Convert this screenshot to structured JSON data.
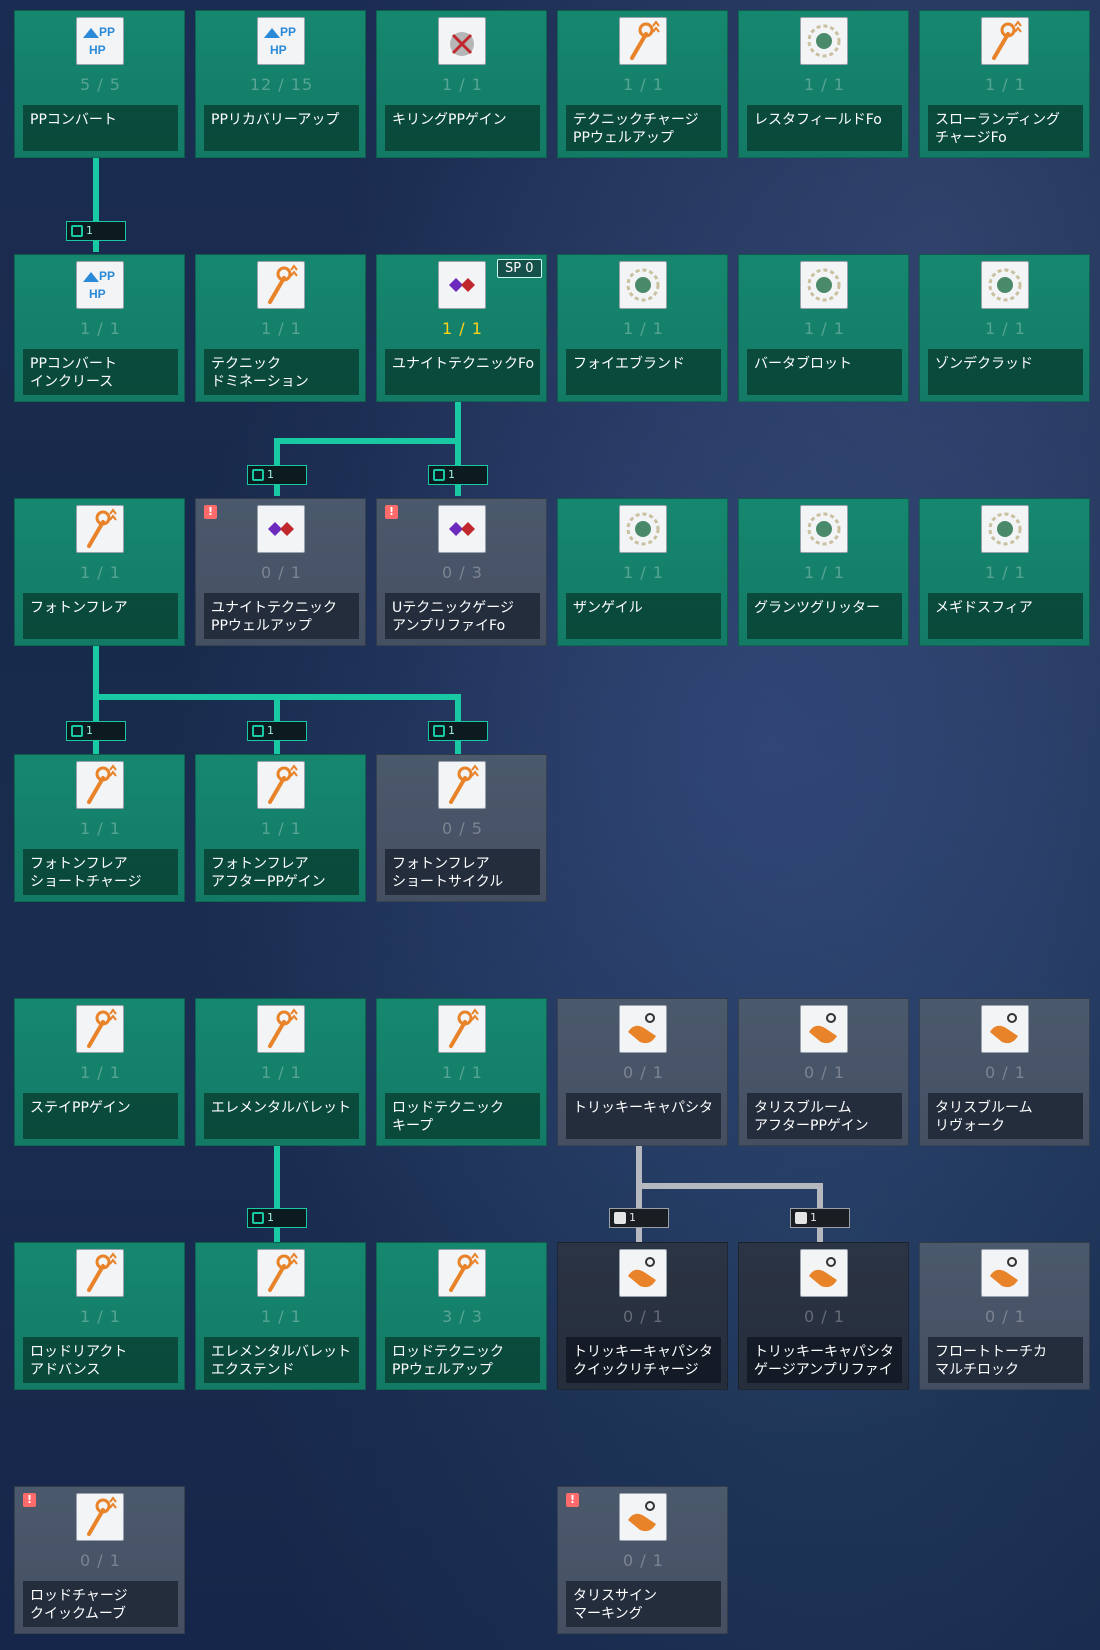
{
  "sp_badge": "SP 0",
  "gates": [
    {
      "value": "1"
    },
    {
      "value": "1"
    },
    {
      "value": "1"
    },
    {
      "value": "1"
    },
    {
      "value": "1"
    },
    {
      "value": "1"
    },
    {
      "value": "1"
    },
    {
      "value": "1"
    },
    {
      "value": "1"
    }
  ],
  "skills": [
    {
      "name": "PPコンバート",
      "level": "5 / 5",
      "state": "learned",
      "icon": "pp-hp-convert-icon"
    },
    {
      "name": "PPリカバリーアップ",
      "level": "12 / 15",
      "state": "learned",
      "icon": "pp-recovery-up-icon"
    },
    {
      "name": "キリングPPゲイン",
      "level": "1 / 1",
      "state": "learned",
      "icon": "killing-pp-gain-icon"
    },
    {
      "name": "テクニックチャージ\nPPウェルアップ",
      "level": "1 / 1",
      "state": "learned",
      "icon": "rod-pp-icon"
    },
    {
      "name": "レスタフィールドFo",
      "level": "1 / 1",
      "state": "learned",
      "icon": "resta-field-icon"
    },
    {
      "name": "スローランディング\nチャージFo",
      "level": "1 / 1",
      "state": "learned",
      "icon": "rod-landing-icon"
    },
    {
      "name": "PPコンバート\nインクリース",
      "level": "1 / 1",
      "state": "learned",
      "icon": "pp-hp-convert-icon"
    },
    {
      "name": "テクニック\nドミネーション",
      "level": "1 / 1",
      "state": "learned",
      "icon": "rod-domination-icon"
    },
    {
      "name": "ユナイトテクニックFo",
      "level": "1 / 1",
      "state": "learned",
      "icon": "unite-technique-icon",
      "highlight": true
    },
    {
      "name": "フォイエブランド",
      "level": "1 / 1",
      "state": "learned",
      "icon": "foie-brand-icon"
    },
    {
      "name": "バータブロット",
      "level": "1 / 1",
      "state": "learned",
      "icon": "barta-blot-icon"
    },
    {
      "name": "ゾンデクラッド",
      "level": "1 / 1",
      "state": "learned",
      "icon": "zonde-clad-icon"
    },
    {
      "name": "フォトンフレア",
      "level": "1 / 1",
      "state": "learned",
      "icon": "photon-flare-icon"
    },
    {
      "name": "ユナイトテクニック\nPPウェルアップ",
      "level": "0 / 1",
      "state": "available",
      "icon": "unite-pp-icon",
      "alert": true
    },
    {
      "name": "Uテクニックゲージ\nアンプリファイFo",
      "level": "0 / 3",
      "state": "available",
      "icon": "unite-gauge-icon",
      "alert": true
    },
    {
      "name": "ザンゲイル",
      "level": "1 / 1",
      "state": "learned",
      "icon": "zan-gale-icon"
    },
    {
      "name": "グランツグリッター",
      "level": "1 / 1",
      "state": "learned",
      "icon": "grants-glitter-icon"
    },
    {
      "name": "メギドスフィア",
      "level": "1 / 1",
      "state": "learned",
      "icon": "megid-sphere-icon"
    },
    {
      "name": "フォトンフレア\nショートチャージ",
      "level": "1 / 1",
      "state": "learned",
      "icon": "rod-short-charge-icon"
    },
    {
      "name": "フォトンフレア\nアフターPPゲイン",
      "level": "1 / 1",
      "state": "learned",
      "icon": "rod-after-pp-icon"
    },
    {
      "name": "フォトンフレア\nショートサイクル",
      "level": "0 / 5",
      "state": "available",
      "icon": "rod-clock-icon"
    },
    {
      "name": "ステイPPゲイン",
      "level": "1 / 1",
      "state": "learned",
      "icon": "rod-stay-pp-icon"
    },
    {
      "name": "エレメンタルバレット",
      "level": "1 / 1",
      "state": "learned",
      "icon": "rod-elemental-icon"
    },
    {
      "name": "ロッドテクニック\nキープ",
      "level": "1 / 1",
      "state": "learned",
      "icon": "rod-keep-icon"
    },
    {
      "name": "トリッキーキャパシタ",
      "level": "0 / 1",
      "state": "available",
      "icon": "tricky-capacitor-icon"
    },
    {
      "name": "タリスブルーム\nアフターPPゲイン",
      "level": "0 / 1",
      "state": "available",
      "icon": "talis-pp-icon"
    },
    {
      "name": "タリスブルーム\nリヴォーク",
      "level": "0 / 1",
      "state": "available",
      "icon": "talis-revoke-icon"
    },
    {
      "name": "ロッドリアクト\nアドバンス",
      "level": "1 / 1",
      "state": "learned",
      "icon": "rod-react-icon"
    },
    {
      "name": "エレメンタルバレット\nエクステンド",
      "level": "1 / 1",
      "state": "learned",
      "icon": "rod-extend-icon"
    },
    {
      "name": "ロッドテクニック\nPPウェルアップ",
      "level": "3 / 3",
      "state": "learned",
      "icon": "rod-pp-wellup-icon"
    },
    {
      "name": "トリッキーキャパシタ\nクイックリチャージ",
      "level": "0 / 1",
      "state": "locked",
      "icon": "tricky-recharge-icon"
    },
    {
      "name": "トリッキーキャパシタ\nゲージアンプリファイ",
      "level": "0 / 1",
      "state": "locked",
      "icon": "tricky-gauge-icon"
    },
    {
      "name": "フロートトーチカ\nマルチロック",
      "level": "0 / 1",
      "state": "available",
      "icon": "talis-multilock-icon"
    },
    {
      "name": "ロッドチャージ\nクイックムーブ",
      "level": "0 / 1",
      "state": "available",
      "icon": "rod-quick-move-icon",
      "alert": true
    },
    {
      "name": "タリスサイン\nマーキング",
      "level": "0 / 1",
      "state": "available",
      "icon": "talis-marking-icon",
      "alert": true
    }
  ]
}
